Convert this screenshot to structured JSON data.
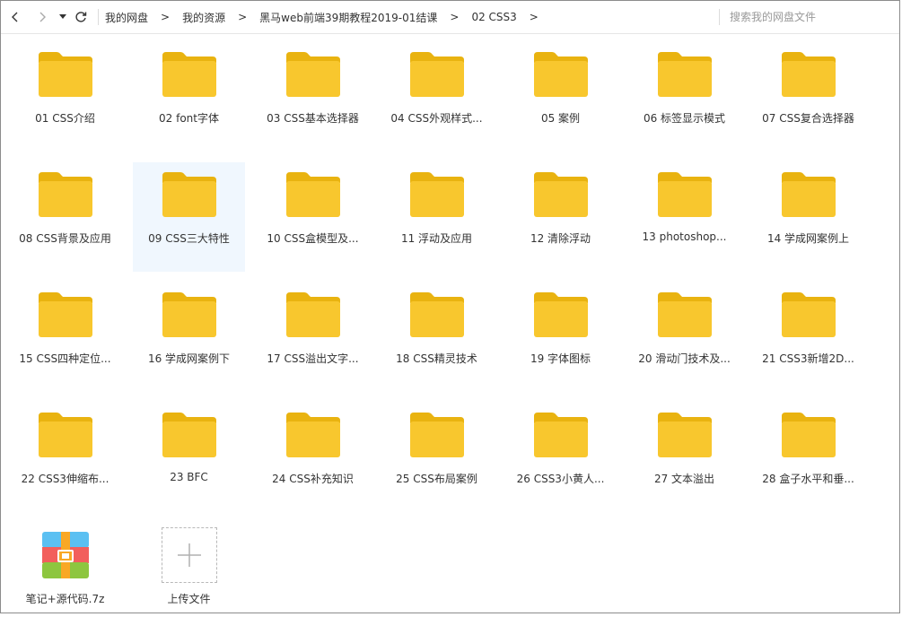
{
  "toolbar": {
    "breadcrumb": [
      "我的网盘",
      "我的资源",
      "黑马web前端39期教程2019-01结课",
      "02 CSS3"
    ],
    "separator": ">",
    "search_placeholder": "搜索我的网盘文件"
  },
  "colors": {
    "folder_body": "#F8C72E",
    "folder_tab": "#E9B310",
    "selected_bg": "#F0F7FE"
  },
  "selected_index": 8,
  "items": [
    {
      "name": "01 CSS介绍",
      "type": "folder"
    },
    {
      "name": "02 font字体",
      "type": "folder"
    },
    {
      "name": "03 CSS基本选择器",
      "type": "folder"
    },
    {
      "name": "04 CSS外观样式...",
      "type": "folder"
    },
    {
      "name": "05 案例",
      "type": "folder"
    },
    {
      "name": "06 标签显示模式",
      "type": "folder"
    },
    {
      "name": "07 CSS复合选择器",
      "type": "folder"
    },
    {
      "name": "08 CSS背景及应用",
      "type": "folder"
    },
    {
      "name": "09 CSS三大特性",
      "type": "folder"
    },
    {
      "name": "10 CSS盒模型及...",
      "type": "folder"
    },
    {
      "name": "11 浮动及应用",
      "type": "folder"
    },
    {
      "name": "12 清除浮动",
      "type": "folder"
    },
    {
      "name": "13 photoshop...",
      "type": "folder"
    },
    {
      "name": "14 学成网案例上",
      "type": "folder"
    },
    {
      "name": "15 CSS四种定位...",
      "type": "folder"
    },
    {
      "name": "16 学成网案例下",
      "type": "folder"
    },
    {
      "name": "17 CSS溢出文字...",
      "type": "folder"
    },
    {
      "name": "18 CSS精灵技术",
      "type": "folder"
    },
    {
      "name": "19 字体图标",
      "type": "folder"
    },
    {
      "name": "20 滑动门技术及...",
      "type": "folder"
    },
    {
      "name": "21 CSS3新增2D...",
      "type": "folder"
    },
    {
      "name": "22 CSS3伸缩布...",
      "type": "folder"
    },
    {
      "name": "23 BFC",
      "type": "folder"
    },
    {
      "name": "24 CSS补充知识",
      "type": "folder"
    },
    {
      "name": "25 CSS布局案例",
      "type": "folder"
    },
    {
      "name": "26 CSS3小黄人...",
      "type": "folder"
    },
    {
      "name": "27 文本溢出",
      "type": "folder"
    },
    {
      "name": "28 盒子水平和垂...",
      "type": "folder"
    },
    {
      "name": "笔记+源代码.7z",
      "type": "archive"
    },
    {
      "name": "上传文件",
      "type": "upload"
    }
  ]
}
